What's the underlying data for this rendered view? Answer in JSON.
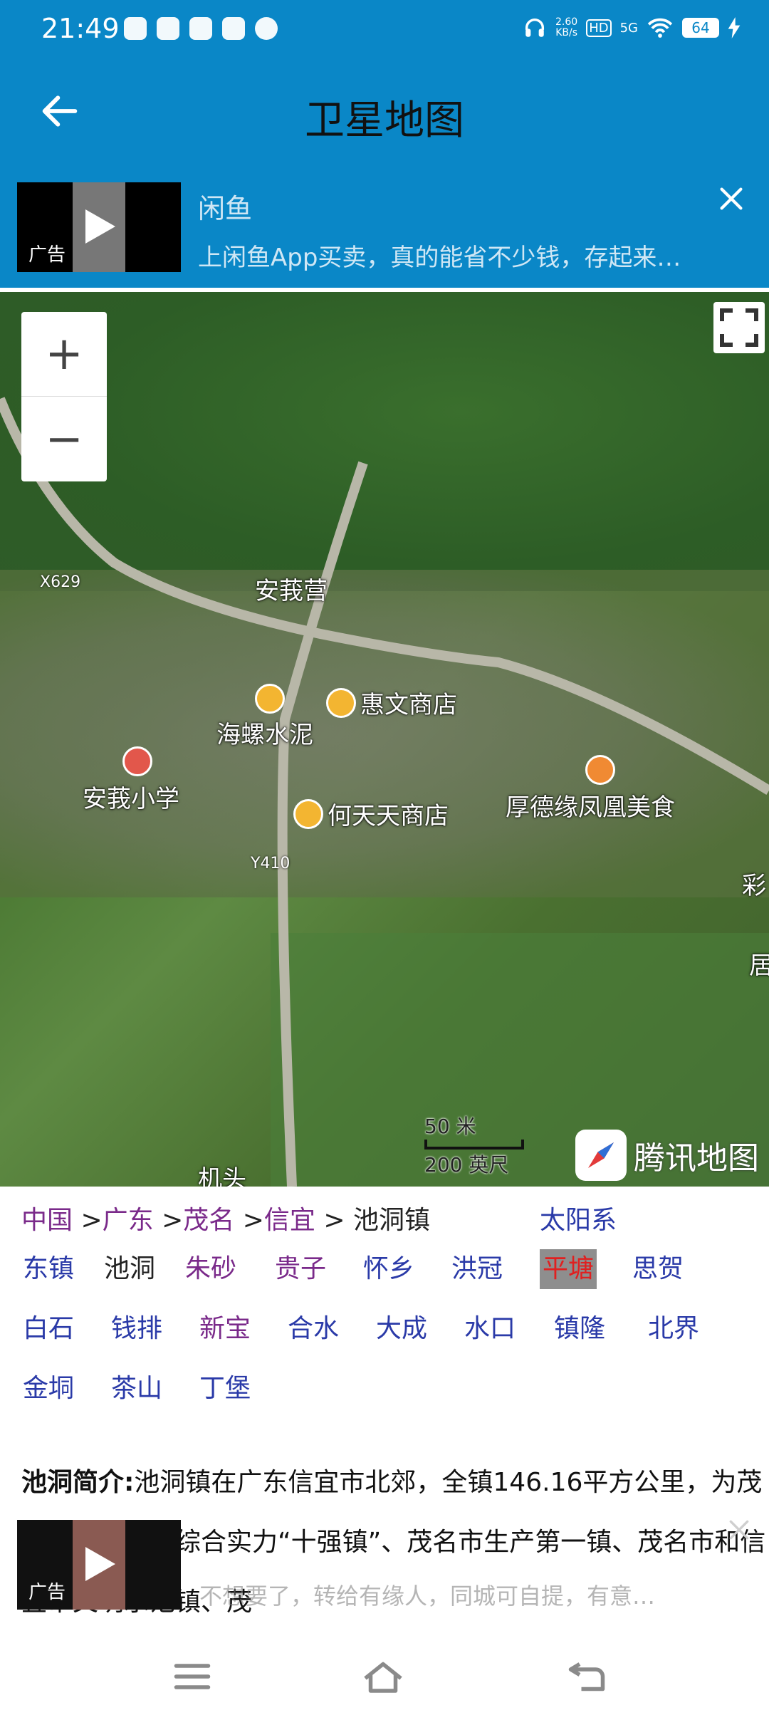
{
  "status_bar": {
    "time": "21:49",
    "net_speed_value": "2.60",
    "net_speed_unit": "KB/s",
    "hd": "HD",
    "signal": "5G",
    "battery": "64"
  },
  "header": {
    "title": "卫星地图"
  },
  "ad_top": {
    "title": "闲鱼",
    "description": "上闲鱼App买卖，真的能省不少钱，存起来…",
    "tag": "广告"
  },
  "map": {
    "pois": {
      "huiwen": "惠文商店",
      "haijiang": "海螺水泥",
      "anyi_school": "安莪小学",
      "hetiantian": "何天天商店",
      "houdeyuan": "厚德缘凤凰美食"
    },
    "places": {
      "anyi_ying": "安莪营",
      "partial_1": "彩",
      "partial_2": "居",
      "partial_3": "机头"
    },
    "road_tags": {
      "x629": "X629",
      "y410": "Y410"
    },
    "scale": {
      "metric": "50 米",
      "imperial": "200 英尺"
    },
    "logo": "腾讯地图"
  },
  "breadcrumb": {
    "items": [
      "中国",
      "广东",
      "茂名",
      "信宜"
    ],
    "separator": ">",
    "current": "池洞镇",
    "solar": "太阳系"
  },
  "places_grid": [
    [
      "东镇",
      "池洞",
      "朱砂",
      "贵子",
      "怀乡",
      "洪冠",
      "平塘",
      "思贺"
    ],
    [
      "白石",
      "钱排",
      "新宝",
      "合水",
      "大成",
      "水口",
      "镇隆",
      "北界"
    ],
    [
      "金垌",
      "茶山",
      "丁堡"
    ]
  ],
  "intro": {
    "heading": "池洞简介:",
    "body": "池洞镇在广东信宜市北郊，全镇146.16平方公里，为茂名市农村经济综合实力“十强镇”、茂名市生产第一镇、茂名市和信宜市文明示范镇、茂"
  },
  "ad_bottom": {
    "tag": "广告",
    "overlay_text": "不想要了，转给有缘人，同城可自提，有意…"
  },
  "colors": {
    "accent": "#0a87c7",
    "link_blue": "#2a3aa8",
    "link_purple": "#7a2a8a",
    "highlight_red": "#e02020"
  }
}
